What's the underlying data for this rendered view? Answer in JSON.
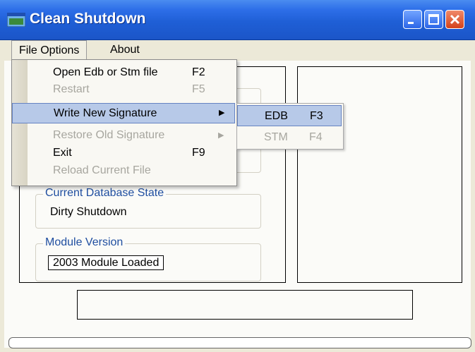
{
  "window": {
    "title": "Clean Shutdown"
  },
  "menubar": {
    "file": "File Options",
    "about": "About"
  },
  "file_menu": {
    "items": [
      {
        "label": "Open Edb or Stm file",
        "shortcut": "F2",
        "enabled": true
      },
      {
        "label": "Restart",
        "shortcut": "F5",
        "enabled": false
      },
      {
        "label": "Write New Signature",
        "shortcut": "",
        "enabled": true,
        "submenu": true,
        "highlighted": true
      },
      {
        "label": "Restore Old Signature",
        "shortcut": "",
        "enabled": false,
        "submenu": true
      },
      {
        "label": "Exit",
        "shortcut": "F9",
        "enabled": true
      },
      {
        "label": "Reload Current File",
        "shortcut": "",
        "enabled": false
      }
    ]
  },
  "submenu": {
    "items": [
      {
        "label": "EDB",
        "shortcut": "F3",
        "enabled": true,
        "highlighted": true
      },
      {
        "label": "STM",
        "shortcut": "F4",
        "enabled": false
      }
    ]
  },
  "main": {
    "state_title": "Current Database State",
    "state_value": "Dirty Shutdown",
    "module_title": "Module Version",
    "module_value": "2003 Module Loaded"
  },
  "icons": {
    "app": "app-window-icon",
    "minimize": "minimize-icon",
    "maximize": "maximize-icon",
    "close": "close-icon"
  },
  "colors": {
    "titlebar": "#1f5fd6",
    "highlight": "#b7c9e8",
    "group_title": "#1f4ea0"
  }
}
